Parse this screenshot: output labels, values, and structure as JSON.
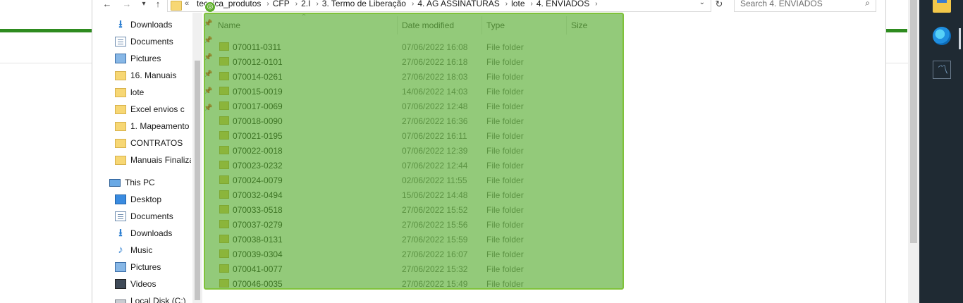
{
  "nav": {
    "back": "←",
    "forward": "→",
    "recent": "▾",
    "up": "↑"
  },
  "address": {
    "overflow": "«",
    "crumbs": [
      "tecnica_produtos",
      "CFP",
      "2.I",
      "3. Termo de Liberação",
      "4. AG ASSINATURAS",
      "lote",
      "4. ENVIADOS"
    ],
    "dropdown": "⌄",
    "refresh": "↻"
  },
  "search": {
    "placeholder": "Search 4. ENVIADOS",
    "icon": "⌕"
  },
  "navpane": {
    "quick_access": [
      {
        "label": "Downloads",
        "icon": "down-arrow-icon",
        "pinned": true
      },
      {
        "label": "Documents",
        "icon": "document-icon",
        "pinned": true
      },
      {
        "label": "Pictures",
        "icon": "pictures-icon",
        "pinned": true
      },
      {
        "label": "16. Manuais",
        "icon": "folder-icon",
        "pinned": true
      },
      {
        "label": "lote",
        "icon": "folder-icon",
        "pinned": true
      },
      {
        "label": "Excel envios c",
        "icon": "folder-icon",
        "pinned": true
      },
      {
        "label": "1. Mapeamento",
        "icon": "folder-icon",
        "pinned": false
      },
      {
        "label": "CONTRATOS",
        "icon": "folder-icon",
        "pinned": false
      },
      {
        "label": "Manuais Finaliza",
        "icon": "folder-icon",
        "pinned": false
      }
    ],
    "this_pc": "This PC",
    "pc_items": [
      {
        "label": "Desktop",
        "icon": "desktop-icon"
      },
      {
        "label": "Documents",
        "icon": "document-icon"
      },
      {
        "label": "Downloads",
        "icon": "down-arrow-icon"
      },
      {
        "label": "Music",
        "icon": "music-icon"
      },
      {
        "label": "Pictures",
        "icon": "pictures-icon"
      },
      {
        "label": "Videos",
        "icon": "videos-icon"
      },
      {
        "label": "Local Disk (C:)",
        "icon": "disk-icon"
      }
    ],
    "pin_glyph": "📌"
  },
  "columns": {
    "name": "Name",
    "date": "Date modified",
    "type": "Type",
    "size": "Size",
    "sort_glyph": "^"
  },
  "files": [
    {
      "name": "070011-0311",
      "date": "07/06/2022 16:08",
      "type": "File folder"
    },
    {
      "name": "070012-0101",
      "date": "27/06/2022 16:18",
      "type": "File folder"
    },
    {
      "name": "070014-0261",
      "date": "27/06/2022 18:03",
      "type": "File folder"
    },
    {
      "name": "070015-0019",
      "date": "14/06/2022 14:03",
      "type": "File folder"
    },
    {
      "name": "070017-0069",
      "date": "07/06/2022 12:48",
      "type": "File folder"
    },
    {
      "name": "070018-0090",
      "date": "27/06/2022 16:36",
      "type": "File folder"
    },
    {
      "name": "070021-0195",
      "date": "07/06/2022 16:11",
      "type": "File folder"
    },
    {
      "name": "070022-0018",
      "date": "07/06/2022 12:39",
      "type": "File folder"
    },
    {
      "name": "070023-0232",
      "date": "07/06/2022 12:44",
      "type": "File folder"
    },
    {
      "name": "070024-0079",
      "date": "02/06/2022 11:55",
      "type": "File folder"
    },
    {
      "name": "070032-0494",
      "date": "15/06/2022 14:48",
      "type": "File folder"
    },
    {
      "name": "070033-0518",
      "date": "27/06/2022 15:52",
      "type": "File folder"
    },
    {
      "name": "070037-0279",
      "date": "27/06/2022 15:56",
      "type": "File folder"
    },
    {
      "name": "070038-0131",
      "date": "27/06/2022 15:59",
      "type": "File folder"
    },
    {
      "name": "070039-0304",
      "date": "27/06/2022 16:07",
      "type": "File folder"
    },
    {
      "name": "070041-0077",
      "date": "27/06/2022 15:32",
      "type": "File folder"
    },
    {
      "name": "070046-0035",
      "date": "27/06/2022 15:49",
      "type": "File folder"
    }
  ],
  "selection_handle": "◎",
  "colors": {
    "selection": "#50aa28",
    "accent_green": "#2e8b1f",
    "taskbar": "#1f2a33"
  }
}
